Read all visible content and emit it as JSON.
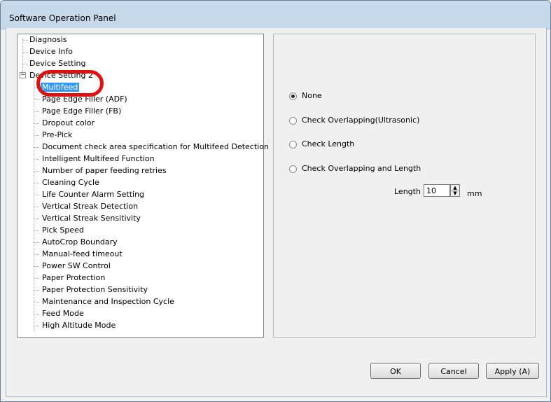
{
  "window": {
    "title": "Software Operation Panel"
  },
  "tree": {
    "items": [
      {
        "label": "Diagnosis"
      },
      {
        "label": "Device Info"
      },
      {
        "label": "Device Setting"
      },
      {
        "label": "Device Setting 2"
      },
      {
        "label": "Multifeed"
      },
      {
        "label": "Page Edge Filler (ADF)"
      },
      {
        "label": "Page Edge Filler (FB)"
      },
      {
        "label": "Dropout color"
      },
      {
        "label": "Pre-Pick"
      },
      {
        "label": "Document check area specification for Multifeed Detection"
      },
      {
        "label": "Intelligent Multifeed Function"
      },
      {
        "label": "Number of paper feeding retries"
      },
      {
        "label": "Cleaning Cycle"
      },
      {
        "label": "Life Counter Alarm Setting"
      },
      {
        "label": "Vertical Streak Detection"
      },
      {
        "label": "Vertical Streak Sensitivity"
      },
      {
        "label": "Pick Speed"
      },
      {
        "label": "AutoCrop Boundary"
      },
      {
        "label": "Manual-feed timeout"
      },
      {
        "label": "Power SW Control"
      },
      {
        "label": "Paper Protection"
      },
      {
        "label": "Paper Protection Sensitivity"
      },
      {
        "label": "Maintenance and Inspection Cycle"
      },
      {
        "label": "Feed Mode"
      },
      {
        "label": "High Altitude Mode"
      }
    ],
    "expander_symbol": "−",
    "selected": "Multifeed"
  },
  "options": {
    "none": "None",
    "ultrasonic": "Check Overlapping(Ultrasonic)",
    "length": "Check Length",
    "overlap_length": "Check Overlapping and Length",
    "selected": "None"
  },
  "length": {
    "label": "Length",
    "value": "10",
    "unit": "mm"
  },
  "buttons": {
    "ok": "OK",
    "cancel": "Cancel",
    "apply": "Apply (A)"
  },
  "colors": {
    "highlight_ring": "#e01010",
    "selection": "#3399ff",
    "titlebar": "#c7daec"
  }
}
